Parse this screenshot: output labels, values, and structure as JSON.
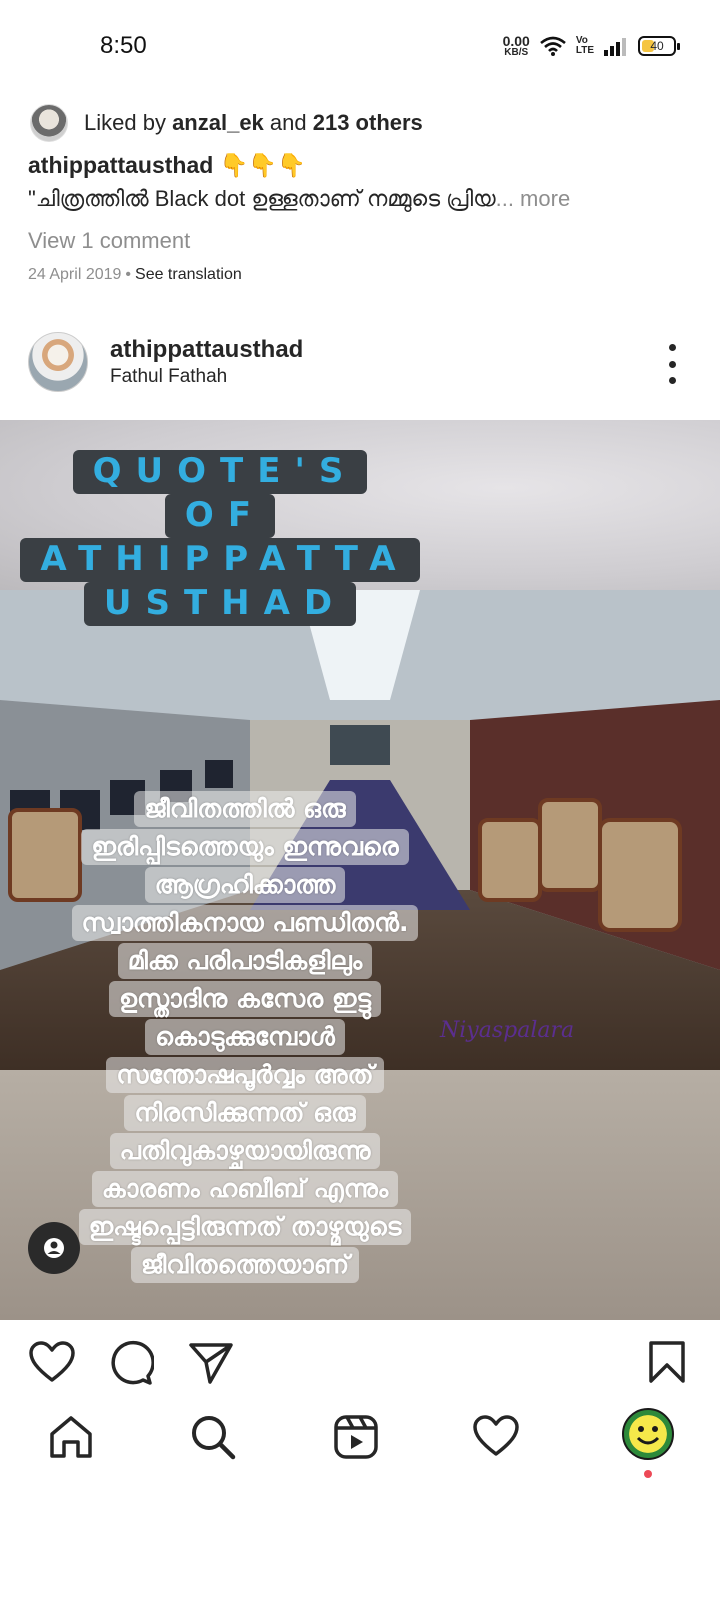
{
  "status_bar": {
    "time": "8:50",
    "net_speed_value": "0.00",
    "net_speed_unit": "KB/S",
    "network_label_top": "Vo",
    "network_label_bottom": "LTE",
    "battery_level": "40",
    "battery_color": "#f5c542"
  },
  "previous_post": {
    "likes_prefix": "Liked by ",
    "likes_user": "anzal_ek",
    "likes_middle": " and ",
    "likes_count": "213 others",
    "caption_user": "athippattausthad",
    "caption_emoji": "👇👇👇",
    "caption_text": "\"ചിത്രത്തിൽ Black dot ഉള്ളതാണ് നമ്മുടെ പ്രിയ",
    "caption_more": "... more",
    "view_comments": "View 1 comment",
    "date": "24 April 2019",
    "date_sep": "•",
    "see_translation": "See translation"
  },
  "post": {
    "username": "athippattausthad",
    "location": "Fathul Fathah",
    "title_lines": [
      "QUOTE'S",
      "OF",
      "ATHIPPATTA",
      "USTHAD"
    ],
    "title_color": "#33aee0",
    "quote_lines": [
      "ജീവിതത്തിൽ ഒരു",
      "ഇരിപ്പിടത്തെയും ഇന്നുവരെ",
      "ആഗ്രഹിക്കാത്ത",
      "സ്വാത്തികനായ പണ്ഡിതൻ.",
      "മിക്ക പരിപാടികളിലും",
      "ഉസ്താദിനു കസേര ഇട്ടു",
      "കൊടുക്കുമ്പോൾ",
      "സന്തോഷപൂർവ്വം അത്",
      "നിരസിക്കുന്നത് ഒരു",
      "പതിവുകാഴ്ചയായിരുന്നു",
      "കാരണം ഹബീബ് എന്നും",
      "ഇഷ്ടപ്പെട്ടിരുന്നത് താഴ്മയുടെ",
      "ജീവിതത്തെയാണ്"
    ],
    "signature": "Niyaspalara"
  },
  "icons": {
    "like": "heart-icon",
    "comment": "comment-icon",
    "share": "send-icon",
    "save": "bookmark-icon",
    "home": "home-icon",
    "search": "search-icon",
    "reels": "reels-icon",
    "activity": "heart-icon",
    "profile": "profile-avatar"
  },
  "colors": {
    "notification_dot": "#ed4956",
    "muted_text": "#8e8e8e"
  }
}
